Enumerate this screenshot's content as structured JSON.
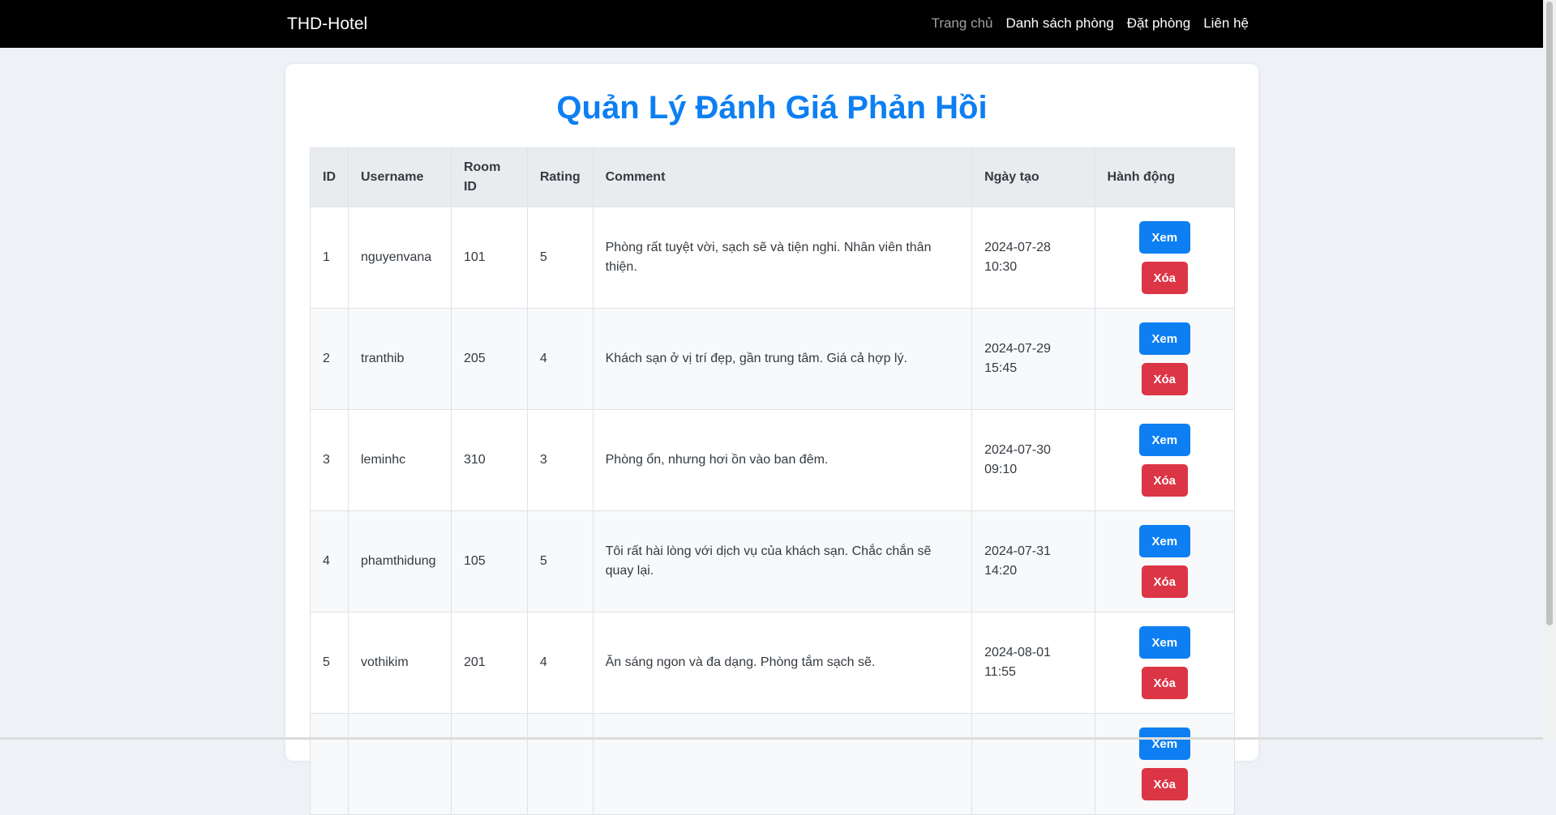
{
  "nav": {
    "brand": "THD-Hotel",
    "links": [
      "Trang chủ",
      "Danh sách phòng",
      "Đặt phòng",
      "Liên hệ"
    ]
  },
  "page": {
    "title": "Quản Lý Đánh Giá Phản Hồi"
  },
  "table": {
    "headers": [
      "ID",
      "Username",
      "Room ID",
      "Rating",
      "Comment",
      "Ngày tạo",
      "Hành động"
    ],
    "rows": [
      {
        "id": "1",
        "username": "nguyenvana",
        "room_id": "101",
        "rating": "5",
        "comment": "Phòng rất tuyệt vời, sạch sẽ và tiện nghi. Nhân viên thân thiện.",
        "date": "2024-07-28",
        "time": "10:30"
      },
      {
        "id": "2",
        "username": "tranthib",
        "room_id": "205",
        "rating": "4",
        "comment": "Khách sạn ở vị trí đẹp, gần trung tâm. Giá cả hợp lý.",
        "date": "2024-07-29",
        "time": "15:45"
      },
      {
        "id": "3",
        "username": "leminhc",
        "room_id": "310",
        "rating": "3",
        "comment": "Phòng ổn, nhưng hơi ồn vào ban đêm.",
        "date": "2024-07-30",
        "time": "09:10"
      },
      {
        "id": "4",
        "username": "phamthidung",
        "room_id": "105",
        "rating": "5",
        "comment": "Tôi rất hài lòng với dịch vụ của khách sạn. Chắc chắn sẽ quay lại.",
        "date": "2024-07-31",
        "time": "14:20"
      },
      {
        "id": "5",
        "username": "vothikim",
        "room_id": "201",
        "rating": "4",
        "comment": "Ăn sáng ngon và đa dạng. Phòng tắm sạch sẽ.",
        "date": "2024-08-01",
        "time": "11:55"
      },
      {
        "id": "",
        "username": "",
        "room_id": "",
        "rating": "",
        "comment": "",
        "date": "",
        "time": ""
      }
    ],
    "actions": {
      "view": "Xem",
      "delete": "Xóa"
    }
  },
  "colors": {
    "accent": "#0d7ff2",
    "danger": "#dc3545",
    "navbar": "#000000"
  }
}
